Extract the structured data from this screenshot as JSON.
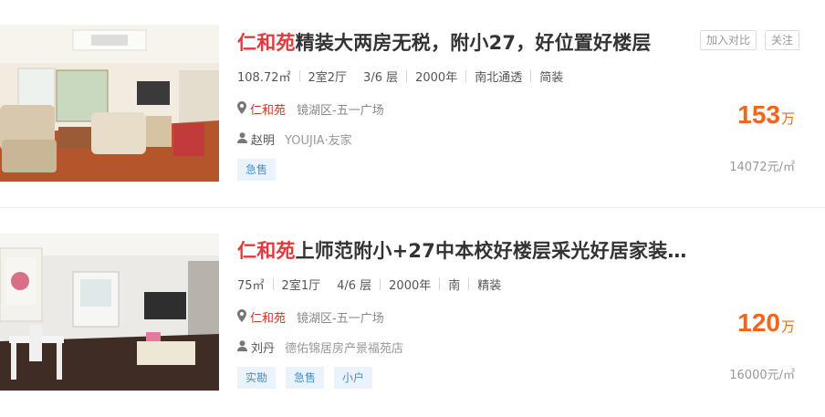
{
  "listings": [
    {
      "title_highlight": "仁和苑",
      "title_rest": "精装大两房无税，附小27，好位置好楼层",
      "actions": {
        "compare": "加入对比",
        "follow": "关注"
      },
      "attrs": [
        "108.72㎡",
        "2室2厅",
        "3/6 层",
        "2000年",
        "南北通透",
        "简装"
      ],
      "community": "仁和苑",
      "district": "镜湖区-五一广场",
      "agent_name": "赵明",
      "agent_company": "YOUJIA·友家",
      "tags": [
        "急售"
      ],
      "price": "153",
      "price_unit": "万",
      "unit_price": "14072元/㎡",
      "icons": {
        "location": "location-pin-icon",
        "agent": "person-icon"
      }
    },
    {
      "title_highlight": "仁和苑",
      "title_rest": "上师范附小+27中本校好楼层采光好居家装…",
      "attrs": [
        "75㎡",
        "2室1厅",
        "4/6 层",
        "2000年",
        "南",
        "精装"
      ],
      "community": "仁和苑",
      "district": "镜湖区-五一广场",
      "agent_name": "刘丹",
      "agent_company": "德佑锦居房产景福苑店",
      "tags": [
        "实勘",
        "急售",
        "小户"
      ],
      "price": "120",
      "price_unit": "万",
      "unit_price": "16000元/㎡",
      "icons": {
        "location": "location-pin-icon",
        "agent": "person-icon"
      }
    }
  ]
}
